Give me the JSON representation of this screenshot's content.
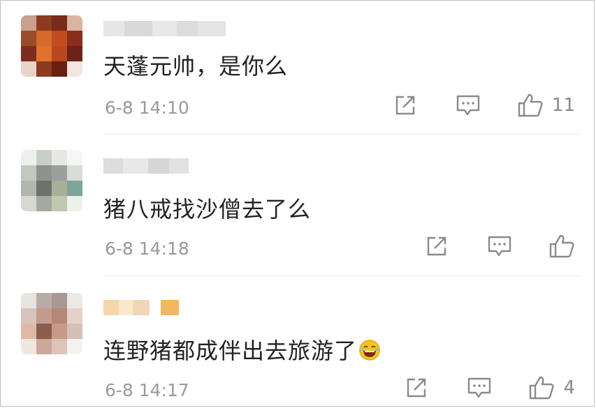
{
  "comments": [
    {
      "text": "天蓬元帅，是你么",
      "timestamp": "6-8 14:10",
      "likes": "11",
      "has_emoji": false
    },
    {
      "text": "猪八戒找沙僧去了么",
      "timestamp": "6-8 14:18",
      "likes": "",
      "has_emoji": false
    },
    {
      "text": "连野猪都成伴出去旅游了",
      "timestamp": "6-8 14:17",
      "likes": "4",
      "has_emoji": true,
      "emoji": "laughing-face-emoji"
    }
  ],
  "icons": {
    "share": "share-icon",
    "reply": "comment-icon",
    "like": "thumbs-up-icon"
  },
  "colors": {
    "text": "#222222",
    "meta": "#9a9a9a",
    "icon": "#8a8a8a",
    "divider": "#ececec"
  }
}
